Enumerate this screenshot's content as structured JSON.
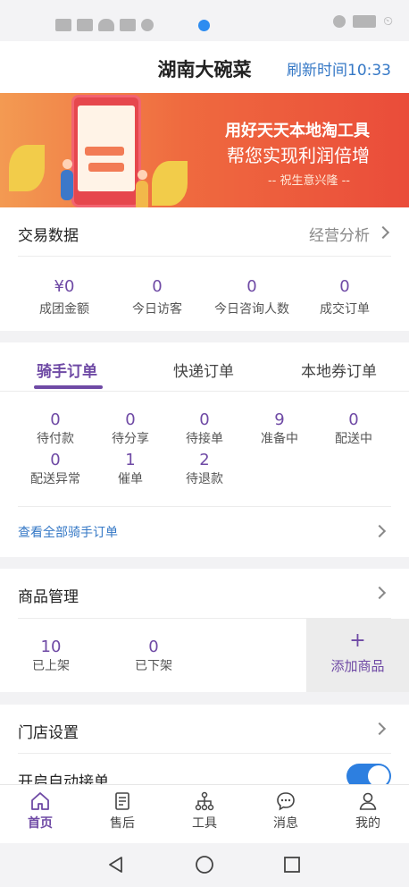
{
  "header": {
    "title": "湖南大碗菜",
    "refresh": "刷新时间10:33"
  },
  "banner": {
    "line1": "用好天天本地淘工具",
    "line2": "帮您实现利润倍增",
    "line3": "-- 祝生意兴隆 --"
  },
  "trade": {
    "title": "交易数据",
    "analysis": "经营分析",
    "stats": [
      {
        "value": "¥0",
        "label": "成团金额"
      },
      {
        "value": "0",
        "label": "今日访客"
      },
      {
        "value": "0",
        "label": "今日咨询人数"
      },
      {
        "value": "0",
        "label": "成交订单"
      }
    ]
  },
  "orders": {
    "tabs": [
      "骑手订单",
      "快递订单",
      "本地券订单"
    ],
    "active_tab": 0,
    "counts": [
      {
        "value": "0",
        "label": "待付款"
      },
      {
        "value": "0",
        "label": "待分享"
      },
      {
        "value": "0",
        "label": "待接单"
      },
      {
        "value": "9",
        "label": "准备中"
      },
      {
        "value": "0",
        "label": "配送中"
      },
      {
        "value": "0",
        "label": "配送异常"
      },
      {
        "value": "1",
        "label": "催单"
      },
      {
        "value": "2",
        "label": "待退款"
      }
    ],
    "view_all": "查看全部骑手订单"
  },
  "goods": {
    "title": "商品管理",
    "stats": [
      {
        "value": "10",
        "label": "已上架"
      },
      {
        "value": "0",
        "label": "已下架"
      }
    ],
    "add_icon": "+",
    "add_label": "添加商品"
  },
  "store": {
    "settings": "门店设置",
    "auto_accept": "开启自动接单",
    "auto_accept_on": true
  },
  "tabbar": [
    {
      "label": "首页",
      "icon": "home-icon",
      "active": true
    },
    {
      "label": "售后",
      "icon": "document-icon",
      "active": false
    },
    {
      "label": "工具",
      "icon": "tools-icon",
      "active": false
    },
    {
      "label": "消息",
      "icon": "message-icon",
      "active": false
    },
    {
      "label": "我的",
      "icon": "user-icon",
      "active": false
    }
  ],
  "colors": {
    "accent": "#6f4aa5",
    "link": "#3578c6",
    "toggle": "#2d7fe0"
  }
}
